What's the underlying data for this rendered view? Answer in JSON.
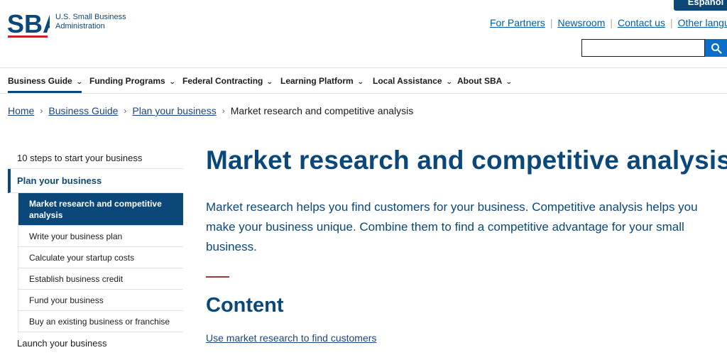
{
  "header": {
    "logo_text": "SBA",
    "agency_line1": "U.S. Small Business",
    "agency_line2": "Administration",
    "espanol_label": "Español",
    "utility_links": [
      "For Partners",
      "Newsroom",
      "Contact us",
      "Other languages"
    ],
    "search": {
      "placeholder": "",
      "value": ""
    }
  },
  "nav": {
    "items": [
      {
        "label": "Business Guide"
      },
      {
        "label": "Funding Programs"
      },
      {
        "label": "Federal Contracting"
      },
      {
        "label": "Learning Platform"
      },
      {
        "label": "Local Assistance"
      },
      {
        "label": "About SBA"
      }
    ]
  },
  "breadcrumb": {
    "items": [
      "Home",
      "Business Guide",
      "Plan your business"
    ],
    "current": "Market research and competitive analysis"
  },
  "sidenav": {
    "top": "10 steps to start your business",
    "current": "Plan your business",
    "subitems": [
      "Market research and competitive analysis",
      "Write your business plan",
      "Calculate your startup costs",
      "Establish business credit",
      "Fund your business",
      "Buy an existing business or franchise"
    ],
    "next": "Launch your business"
  },
  "main": {
    "title": "Market research and competitive analysis",
    "intro": "Market research helps you find customers for your business. Competitive analysis helps you make your business unique. Combine them to find a competitive advantage for your small business.",
    "content_heading": "Content",
    "first_link": "Use market research to find customers"
  },
  "colors": {
    "brand": "#0b4778",
    "link": "#1a4480",
    "accent_red": "#a23737",
    "search_button": "#0b6ec8"
  }
}
